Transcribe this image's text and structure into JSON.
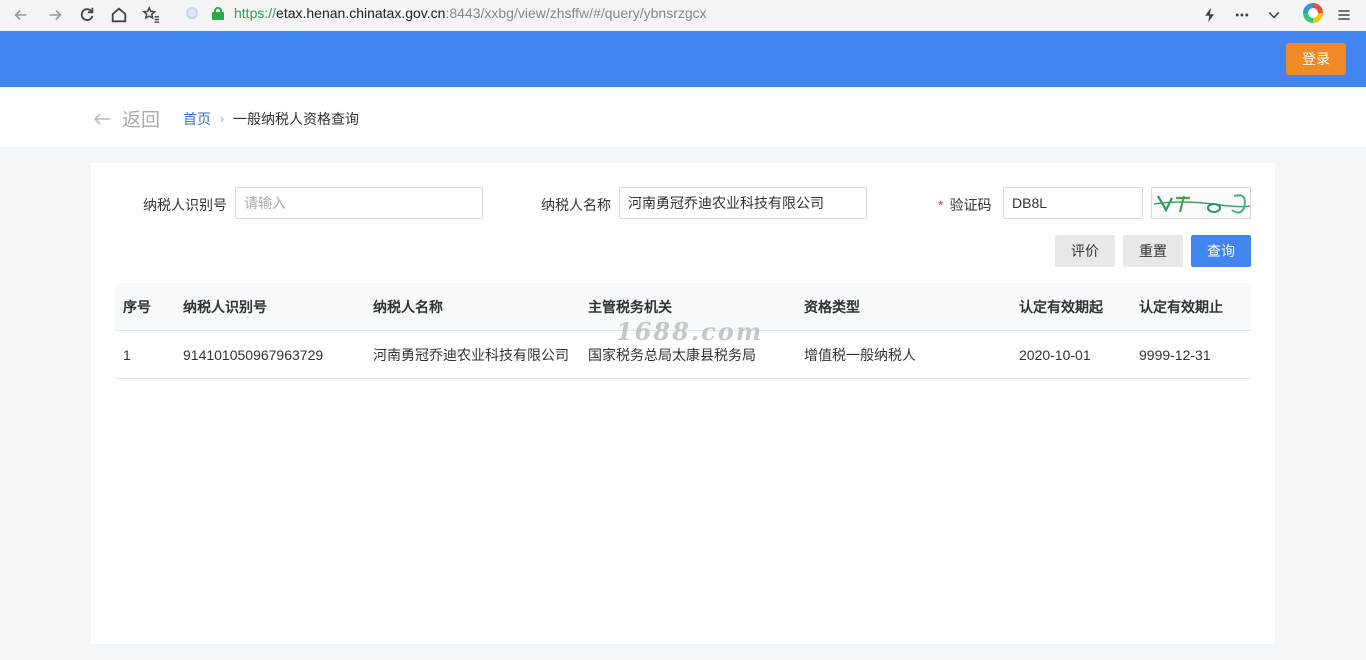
{
  "browser": {
    "url_protocol": "https://",
    "url_host": "etax.henan.chinatax.gov.cn",
    "url_path": ":8443/xxbg/view/zhsffw/#/query/ybnsrzgcx",
    "icons": [
      "back-arrow-icon",
      "forward-arrow-icon",
      "reload-icon",
      "home-icon",
      "bookmark-star-icon",
      "lock-icon",
      "lightning-icon",
      "more-icon",
      "chevron-down-icon",
      "extension-icon",
      "menu-icon"
    ]
  },
  "header": {
    "login_label": "登录",
    "login_color": "#f08a24",
    "bar_color": "#4285f0"
  },
  "breadcrumb": {
    "back_label": "返回",
    "home": "首页",
    "current": "一般纳税人资格查询"
  },
  "form": {
    "taxpayer_id_label": "纳税人识别号",
    "taxpayer_id_placeholder": "请输入",
    "taxpayer_id_value": "",
    "taxpayer_name_label": "纳税人名称",
    "taxpayer_name_value": "河南勇冠乔迪农业科技有限公司",
    "captcha_required_mark": "*",
    "captcha_label": "验证码",
    "captcha_value": "DB8L"
  },
  "buttons": {
    "evaluate": "评价",
    "reset": "重置",
    "query": "查询"
  },
  "table": {
    "columns": [
      "序号",
      "纳税人识别号",
      "纳税人名称",
      "主管税务机关",
      "资格类型",
      "认定有效期起",
      "认定有效期止"
    ],
    "rows": [
      [
        "1",
        "914101050967963729",
        "河南勇冠乔迪农业科技有限公司",
        "国家税务总局太康县税务局",
        "增值税一般纳税人",
        "2020-10-01",
        "9999-12-31"
      ]
    ]
  },
  "watermark": "1688.com"
}
